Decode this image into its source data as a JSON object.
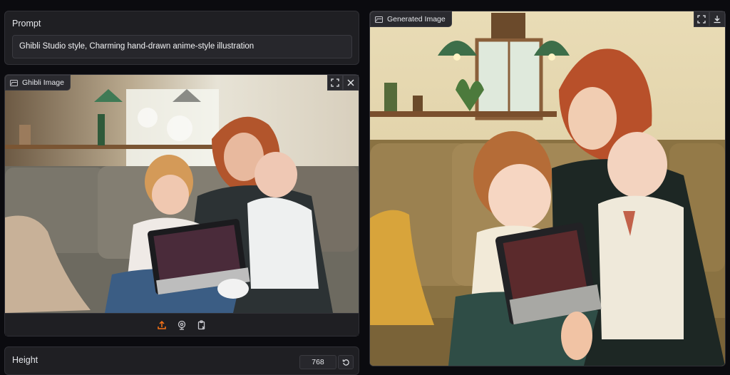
{
  "prompt": {
    "label": "Prompt",
    "value": "Ghibli Studio style, Charming hand-drawn anime-style illustration"
  },
  "input_image": {
    "label": "Ghibli Image",
    "controls": [
      "fullscreen-icon",
      "close-icon"
    ],
    "toolbar_icons": [
      "upload-icon",
      "webcam-icon",
      "clipboard-icon"
    ]
  },
  "output_image": {
    "label": "Generated Image",
    "controls": [
      "fullscreen-icon",
      "download-icon"
    ]
  },
  "height": {
    "label": "Height",
    "value": "768"
  },
  "colors": {
    "accent": "#f97316",
    "panel": "#1f1f23",
    "background": "#0b0b0f"
  }
}
